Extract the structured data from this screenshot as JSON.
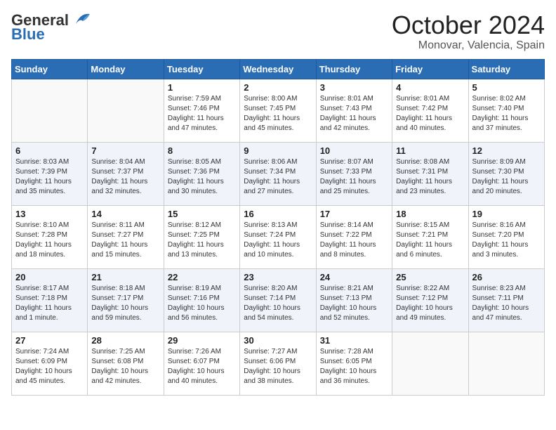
{
  "logo": {
    "general": "General",
    "blue": "Blue"
  },
  "header": {
    "month": "October 2024",
    "location": "Monovar, Valencia, Spain"
  },
  "days_of_week": [
    "Sunday",
    "Monday",
    "Tuesday",
    "Wednesday",
    "Thursday",
    "Friday",
    "Saturday"
  ],
  "weeks": [
    [
      {
        "day": "",
        "info": ""
      },
      {
        "day": "",
        "info": ""
      },
      {
        "day": "1",
        "info": "Sunrise: 7:59 AM\nSunset: 7:46 PM\nDaylight: 11 hours and 47 minutes."
      },
      {
        "day": "2",
        "info": "Sunrise: 8:00 AM\nSunset: 7:45 PM\nDaylight: 11 hours and 45 minutes."
      },
      {
        "day": "3",
        "info": "Sunrise: 8:01 AM\nSunset: 7:43 PM\nDaylight: 11 hours and 42 minutes."
      },
      {
        "day": "4",
        "info": "Sunrise: 8:01 AM\nSunset: 7:42 PM\nDaylight: 11 hours and 40 minutes."
      },
      {
        "day": "5",
        "info": "Sunrise: 8:02 AM\nSunset: 7:40 PM\nDaylight: 11 hours and 37 minutes."
      }
    ],
    [
      {
        "day": "6",
        "info": "Sunrise: 8:03 AM\nSunset: 7:39 PM\nDaylight: 11 hours and 35 minutes."
      },
      {
        "day": "7",
        "info": "Sunrise: 8:04 AM\nSunset: 7:37 PM\nDaylight: 11 hours and 32 minutes."
      },
      {
        "day": "8",
        "info": "Sunrise: 8:05 AM\nSunset: 7:36 PM\nDaylight: 11 hours and 30 minutes."
      },
      {
        "day": "9",
        "info": "Sunrise: 8:06 AM\nSunset: 7:34 PM\nDaylight: 11 hours and 27 minutes."
      },
      {
        "day": "10",
        "info": "Sunrise: 8:07 AM\nSunset: 7:33 PM\nDaylight: 11 hours and 25 minutes."
      },
      {
        "day": "11",
        "info": "Sunrise: 8:08 AM\nSunset: 7:31 PM\nDaylight: 11 hours and 23 minutes."
      },
      {
        "day": "12",
        "info": "Sunrise: 8:09 AM\nSunset: 7:30 PM\nDaylight: 11 hours and 20 minutes."
      }
    ],
    [
      {
        "day": "13",
        "info": "Sunrise: 8:10 AM\nSunset: 7:28 PM\nDaylight: 11 hours and 18 minutes."
      },
      {
        "day": "14",
        "info": "Sunrise: 8:11 AM\nSunset: 7:27 PM\nDaylight: 11 hours and 15 minutes."
      },
      {
        "day": "15",
        "info": "Sunrise: 8:12 AM\nSunset: 7:25 PM\nDaylight: 11 hours and 13 minutes."
      },
      {
        "day": "16",
        "info": "Sunrise: 8:13 AM\nSunset: 7:24 PM\nDaylight: 11 hours and 10 minutes."
      },
      {
        "day": "17",
        "info": "Sunrise: 8:14 AM\nSunset: 7:22 PM\nDaylight: 11 hours and 8 minutes."
      },
      {
        "day": "18",
        "info": "Sunrise: 8:15 AM\nSunset: 7:21 PM\nDaylight: 11 hours and 6 minutes."
      },
      {
        "day": "19",
        "info": "Sunrise: 8:16 AM\nSunset: 7:20 PM\nDaylight: 11 hours and 3 minutes."
      }
    ],
    [
      {
        "day": "20",
        "info": "Sunrise: 8:17 AM\nSunset: 7:18 PM\nDaylight: 11 hours and 1 minute."
      },
      {
        "day": "21",
        "info": "Sunrise: 8:18 AM\nSunset: 7:17 PM\nDaylight: 10 hours and 59 minutes."
      },
      {
        "day": "22",
        "info": "Sunrise: 8:19 AM\nSunset: 7:16 PM\nDaylight: 10 hours and 56 minutes."
      },
      {
        "day": "23",
        "info": "Sunrise: 8:20 AM\nSunset: 7:14 PM\nDaylight: 10 hours and 54 minutes."
      },
      {
        "day": "24",
        "info": "Sunrise: 8:21 AM\nSunset: 7:13 PM\nDaylight: 10 hours and 52 minutes."
      },
      {
        "day": "25",
        "info": "Sunrise: 8:22 AM\nSunset: 7:12 PM\nDaylight: 10 hours and 49 minutes."
      },
      {
        "day": "26",
        "info": "Sunrise: 8:23 AM\nSunset: 7:11 PM\nDaylight: 10 hours and 47 minutes."
      }
    ],
    [
      {
        "day": "27",
        "info": "Sunrise: 7:24 AM\nSunset: 6:09 PM\nDaylight: 10 hours and 45 minutes."
      },
      {
        "day": "28",
        "info": "Sunrise: 7:25 AM\nSunset: 6:08 PM\nDaylight: 10 hours and 42 minutes."
      },
      {
        "day": "29",
        "info": "Sunrise: 7:26 AM\nSunset: 6:07 PM\nDaylight: 10 hours and 40 minutes."
      },
      {
        "day": "30",
        "info": "Sunrise: 7:27 AM\nSunset: 6:06 PM\nDaylight: 10 hours and 38 minutes."
      },
      {
        "day": "31",
        "info": "Sunrise: 7:28 AM\nSunset: 6:05 PM\nDaylight: 10 hours and 36 minutes."
      },
      {
        "day": "",
        "info": ""
      },
      {
        "day": "",
        "info": ""
      }
    ]
  ]
}
